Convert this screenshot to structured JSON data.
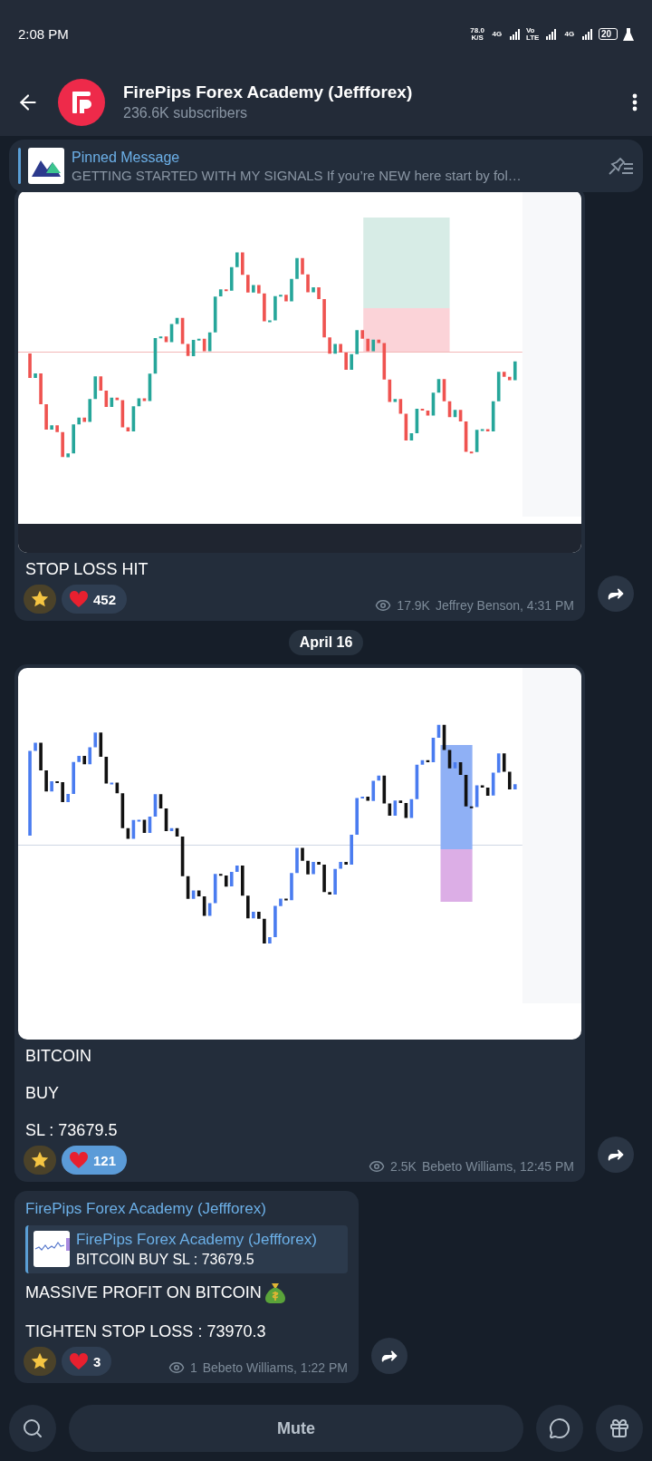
{
  "status_bar": {
    "time": "2:08 PM",
    "net_speed": "78.0",
    "net_unit": "K/S",
    "networks": [
      "4G",
      "Vo LTE",
      "4G"
    ],
    "battery": "20"
  },
  "header": {
    "title": "FirePips Forex Academy (Jeffforex)",
    "subtitle": "236.6K subscribers"
  },
  "pinned": {
    "title": "Pinned Message",
    "text": "GETTING STARTED WITH MY SIGNALS   If you’re NEW here start by fol…"
  },
  "messages": [
    {
      "attachment": {
        "kind": "picture"
      },
      "paragraphs": [
        "STOP LOSS HIT"
      ],
      "reactions": [
        {
          "kind": "star",
          "selected": false
        },
        {
          "kind": "heart",
          "count": "452",
          "selected": false
        }
      ],
      "views": "17.9K",
      "signature": "Jeffrey Benson, 4:31 PM"
    },
    {
      "kind": "date",
      "label": "April 16"
    },
    {
      "attachment": {
        "kind": "picture"
      },
      "paragraphs": [
        "BITCOIN",
        "BUY",
        "SL : 73679.5"
      ],
      "reactions": [
        {
          "kind": "star",
          "selected": false
        },
        {
          "kind": "heart",
          "count": "121",
          "selected": true
        }
      ],
      "views": "2.5K",
      "signature": "Bebeto Williams, 12:45 PM"
    },
    {
      "kind": "reply",
      "sender": "FirePips Forex Academy (Jeffforex)",
      "reply": {
        "title": "FirePips Forex Academy (Jeffforex)",
        "text": "BITCOIN  BUY  SL : 73679.5",
        "thumbnail": {
          "kind": "picture"
        }
      },
      "paragraphs": [
        "MASSIVE PROFIT ON BITCOIN",
        "TIGHTEN STOP LOSS : 73970.3"
      ],
      "reactions": [
        {
          "kind": "star",
          "selected": false
        },
        {
          "kind": "heart",
          "count": "3",
          "selected": false
        }
      ],
      "views": "1",
      "signature": "Bebeto Williams, 1:22 PM"
    }
  ],
  "bottom_bar": {
    "button": "Mute"
  }
}
